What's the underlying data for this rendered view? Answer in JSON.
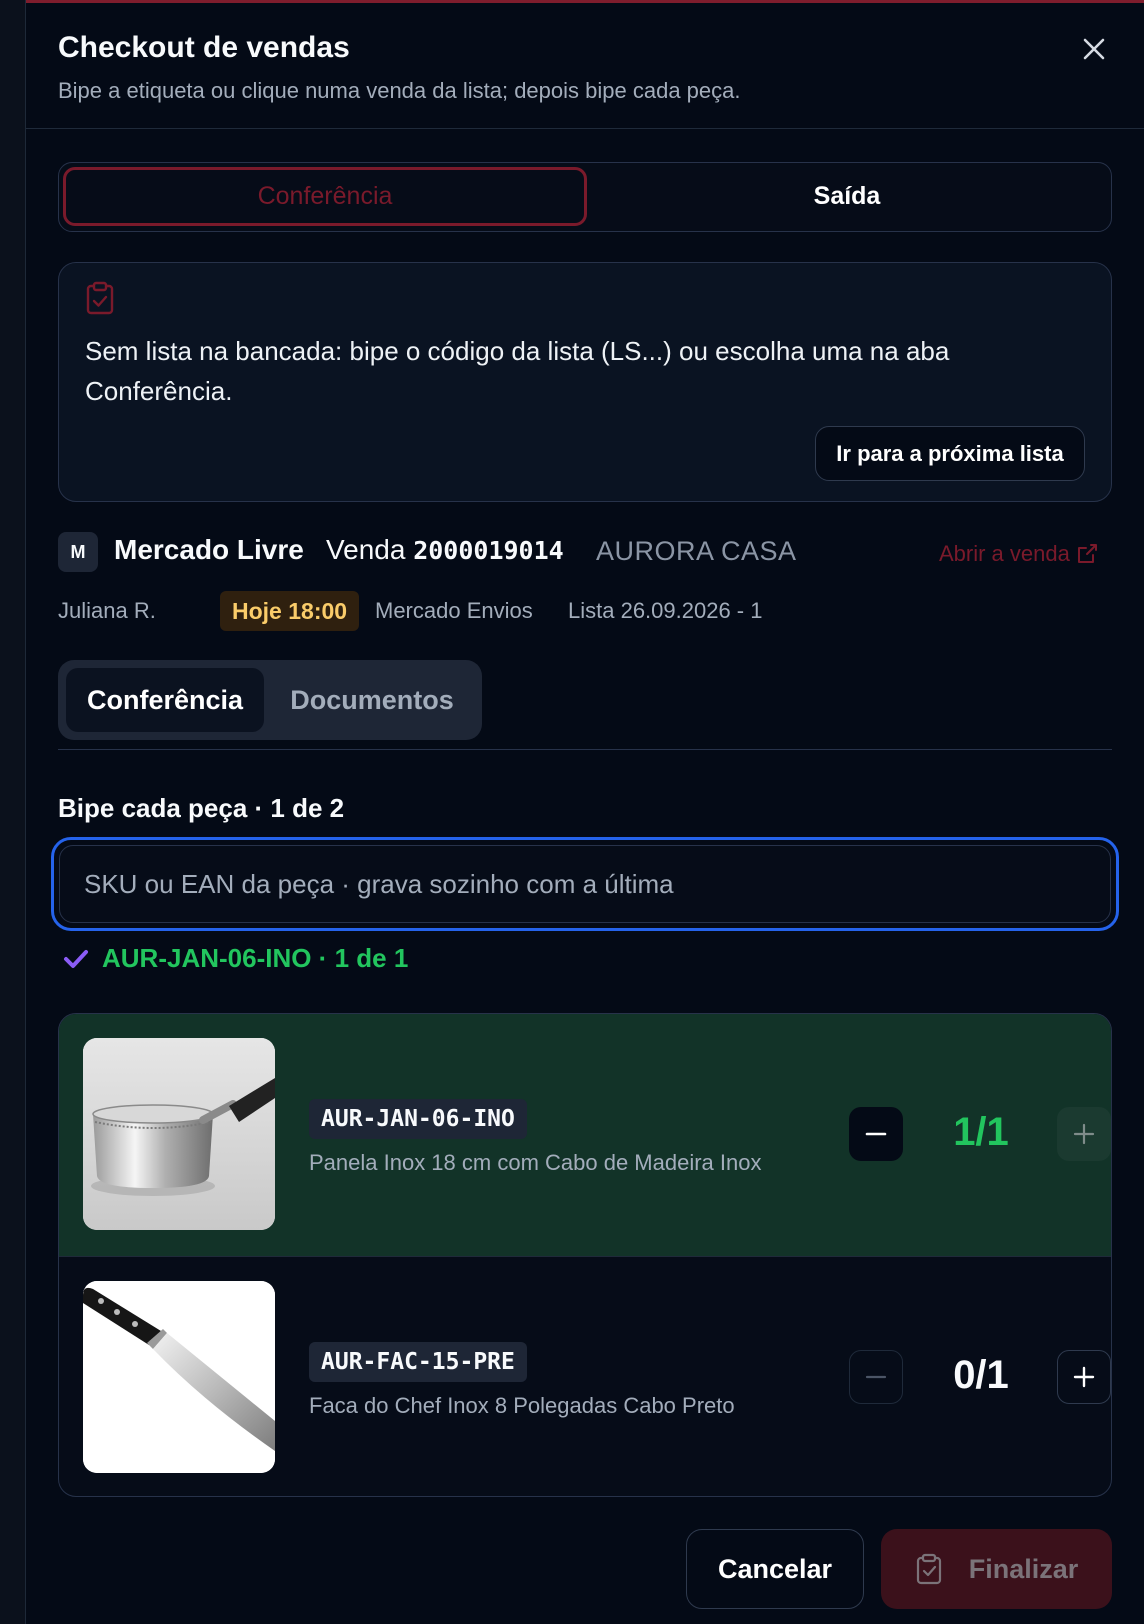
{
  "dialog": {
    "title": "Checkout de vendas",
    "subtitle": "Bipe a etiqueta ou clique numa venda da lista; depois bipe cada peça."
  },
  "mode_tabs": [
    {
      "label": "Conferência",
      "state": "disabled"
    },
    {
      "label": "Saída",
      "state": "selected"
    }
  ],
  "notice": {
    "text": "Sem lista na bancada: bipe o código da lista (LS...) ou escolha uma na aba Conferência.",
    "button_label": "Ir para a próxima lista"
  },
  "order": {
    "marketplace_initial": "M",
    "marketplace": "Mercado Livre",
    "venda_label": "Venda",
    "venda_number": "2000019014",
    "store": "AURORA CASA",
    "open_link": "Abrir a venda",
    "buyer": "Juliana R.",
    "deadline": "Hoje 18:00",
    "shipping": "Mercado Envios",
    "list": "Lista 26.09.2026 - 1"
  },
  "section_tabs": [
    {
      "label": "Conferência",
      "active": true
    },
    {
      "label": "Documentos",
      "active": false
    }
  ],
  "scan": {
    "label": "Bipe cada peça · 1 de 2",
    "placeholder": "SKU ou EAN da peça · grava sozinho com a última",
    "value": "",
    "last_scan": "AUR-JAN-06-INO · 1 de 1"
  },
  "items": [
    {
      "sku": "AUR-JAN-06-INO",
      "description": "Panela Inox 18 cm com Cabo de Madeira Inox",
      "quantity": "1/1",
      "scanned": 1,
      "required": 1,
      "image": "saucepan"
    },
    {
      "sku": "AUR-FAC-15-PRE",
      "description": "Faca do Chef Inox 8 Polegadas Cabo Preto",
      "quantity": "0/1",
      "scanned": 0,
      "required": 1,
      "image": "chef-knife"
    }
  ],
  "footer": {
    "cancel_label": "Cancelar",
    "finish_label": "Finalizar"
  },
  "colors": {
    "accent": "#7a1a2b",
    "success": "#22c55e",
    "focus": "#2563eb",
    "warning": "#facc6a",
    "background": "#040a16"
  }
}
